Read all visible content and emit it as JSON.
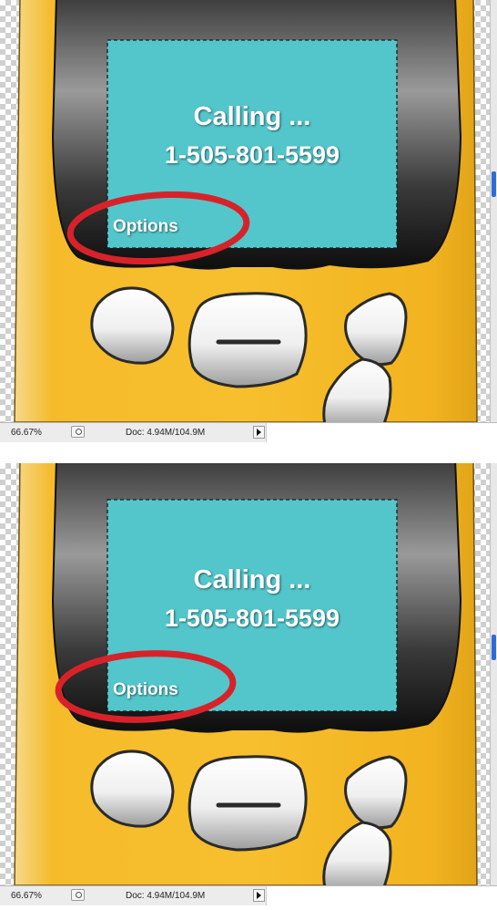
{
  "panels": [
    {
      "screen": {
        "line1": "Calling ...",
        "line2": "1-505-801-5599",
        "softkey": "Options"
      },
      "status": {
        "zoom": "66.67%",
        "doc": "Doc: 4.94M/104.9M"
      }
    },
    {
      "screen": {
        "line1": "Calling ...",
        "line2": "1-505-801-5599",
        "softkey": "Options"
      },
      "status": {
        "zoom": "66.67%",
        "doc": "Doc: 4.94M/104.9M"
      }
    }
  ],
  "icons": {
    "navigator": "navigator-icon",
    "status_menu": "triangle-right-icon"
  },
  "colors": {
    "phone_body": "#f5b820",
    "screen": "#4dc7cc",
    "annotation": "#d8222a",
    "scroll_thumb": "#2e6cd3"
  }
}
